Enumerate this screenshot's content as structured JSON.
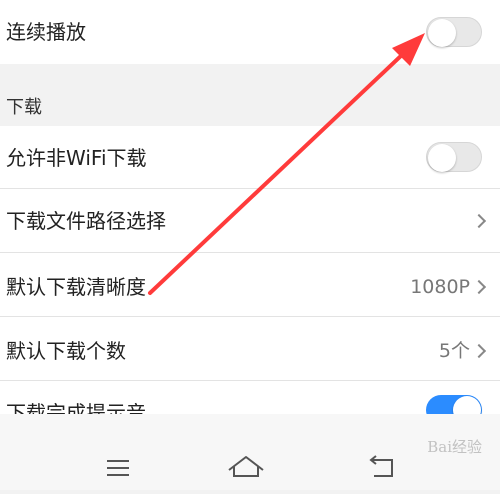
{
  "settings": {
    "continuous_play": {
      "label": "连续播放",
      "enabled": false
    },
    "download_section": {
      "title": "下载"
    },
    "allow_non_wifi": {
      "label": "允许非WiFi下载",
      "enabled": false
    },
    "download_path": {
      "label": "下载文件路径选择"
    },
    "default_quality": {
      "label": "默认下载清晰度",
      "value": "1080P"
    },
    "default_count": {
      "label": "默认下载个数",
      "value": "5个"
    },
    "completion_sound": {
      "label": "下载完成提示音",
      "enabled": true
    }
  },
  "navbar": {
    "menu_icon": "menu-icon",
    "home_icon": "home-icon",
    "back_icon": "back-icon"
  },
  "watermark": {
    "text": "Bai经验"
  },
  "colors": {
    "accent": "#2b8cff",
    "annotation_arrow": "#ff3b3b",
    "toggle_off": "#e8e8e8"
  }
}
